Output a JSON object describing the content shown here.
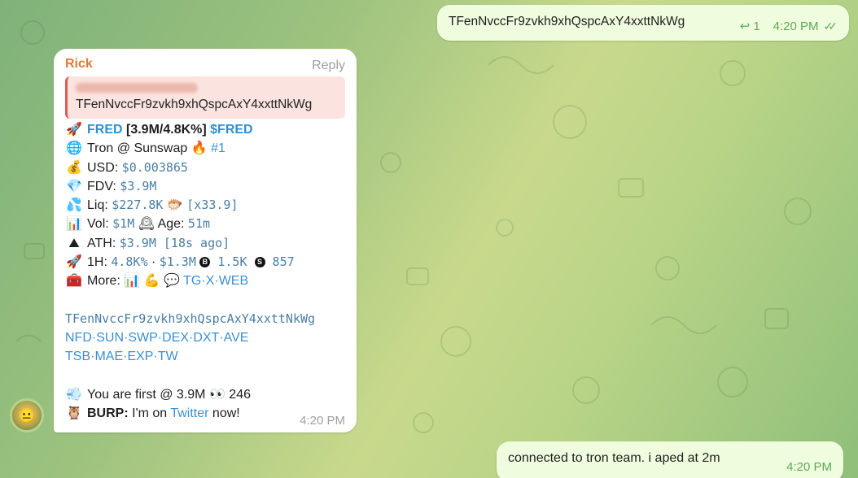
{
  "outgoing_top": {
    "text": "TFenNvccFr9zvkh9xhQspcAxY4xxttNkWg",
    "reply_count": "1",
    "time": "4:20 PM"
  },
  "incoming": {
    "sender": "Rick",
    "reply_label": "Reply",
    "quote_text": "TFenNvccFr9zvkh9xhQspcAxY4xxttNkWg",
    "lines": [
      {
        "emoji": "🚀",
        "parts": [
          {
            "t": "FRED",
            "c": "blue-b"
          },
          {
            "t": " [3.9M/4.8K%] ",
            "c": "bold"
          },
          {
            "t": "$FRED",
            "c": "blue-b"
          }
        ]
      },
      {
        "emoji": "🌐",
        "parts": [
          {
            "t": "Tron @ Sunswap ",
            "c": ""
          },
          {
            "t": "🔥",
            "c": ""
          },
          {
            "t": " #1",
            "c": "link"
          }
        ]
      },
      {
        "emoji": "💰",
        "parts": [
          {
            "t": "USD: ",
            "c": ""
          },
          {
            "t": "$0.003865",
            "c": "mono"
          }
        ]
      },
      {
        "emoji": "💎",
        "parts": [
          {
            "t": "FDV: ",
            "c": ""
          },
          {
            "t": "$3.9M",
            "c": "mono"
          }
        ]
      },
      {
        "emoji": "💦",
        "parts": [
          {
            "t": "Liq: ",
            "c": ""
          },
          {
            "t": "$227.8K",
            "c": "mono"
          },
          {
            "t": " 🐡 ",
            "c": ""
          },
          {
            "t": "[x33.9]",
            "c": "mono"
          }
        ]
      },
      {
        "emoji": "📊",
        "parts": [
          {
            "t": "Vol: ",
            "c": ""
          },
          {
            "t": "$1M",
            "c": "mono"
          },
          {
            "t": " 🕰 ",
            "c": ""
          },
          {
            "t": "Age: ",
            "c": ""
          },
          {
            "t": "51m",
            "c": "mono"
          }
        ]
      },
      {
        "emoji": "⛰",
        "parts": [
          {
            "t": "ATH: ",
            "c": ""
          },
          {
            "t": "$3.9M [18s ago]",
            "c": "mono"
          }
        ]
      },
      {
        "emoji": "🚀",
        "parts": [
          {
            "t": "1H: ",
            "c": ""
          },
          {
            "t": "4.8K%",
            "c": "mono"
          },
          {
            "t": " · ",
            "c": ""
          },
          {
            "t": "$1.3M",
            "c": "mono"
          },
          {
            "t": " ",
            "c": ""
          },
          {
            "t": "B",
            "c": "coin"
          },
          {
            "t": " 1.5K ",
            "c": "mono"
          },
          {
            "t": "S",
            "c": "coin"
          },
          {
            "t": " 857",
            "c": "mono"
          }
        ]
      },
      {
        "emoji": "🧰",
        "parts": [
          {
            "t": "More: ",
            "c": ""
          },
          {
            "t": "📊 💪 💬 ",
            "c": ""
          },
          {
            "t": "TG·X·WEB",
            "c": "link"
          }
        ]
      }
    ],
    "address": "TFenNvccFr9zvkh9xhQspcAxY4xxttNkWg",
    "links_row1": "NFD·SUN·SWP·DEX·DXT·AVE",
    "links_row2": "TSB·MAE·EXP·TW",
    "footer1": {
      "emoji": "💨",
      "text": "You are first @ 3.9M 👀 246"
    },
    "footer2": {
      "emoji": "🦉",
      "bold": "BURP:",
      "text": " I'm on ",
      "link": "Twitter",
      "after": " now!"
    },
    "time": "4:20 PM"
  },
  "outgoing_bottom": {
    "text": "connected to tron team. i aped at 2m",
    "time": "4:20 PM"
  },
  "colors": {
    "outgoing_bg": "#effdde",
    "sender": "#e17a35",
    "link": "#3a8fd6",
    "quote_bar": "#e05b4d"
  }
}
